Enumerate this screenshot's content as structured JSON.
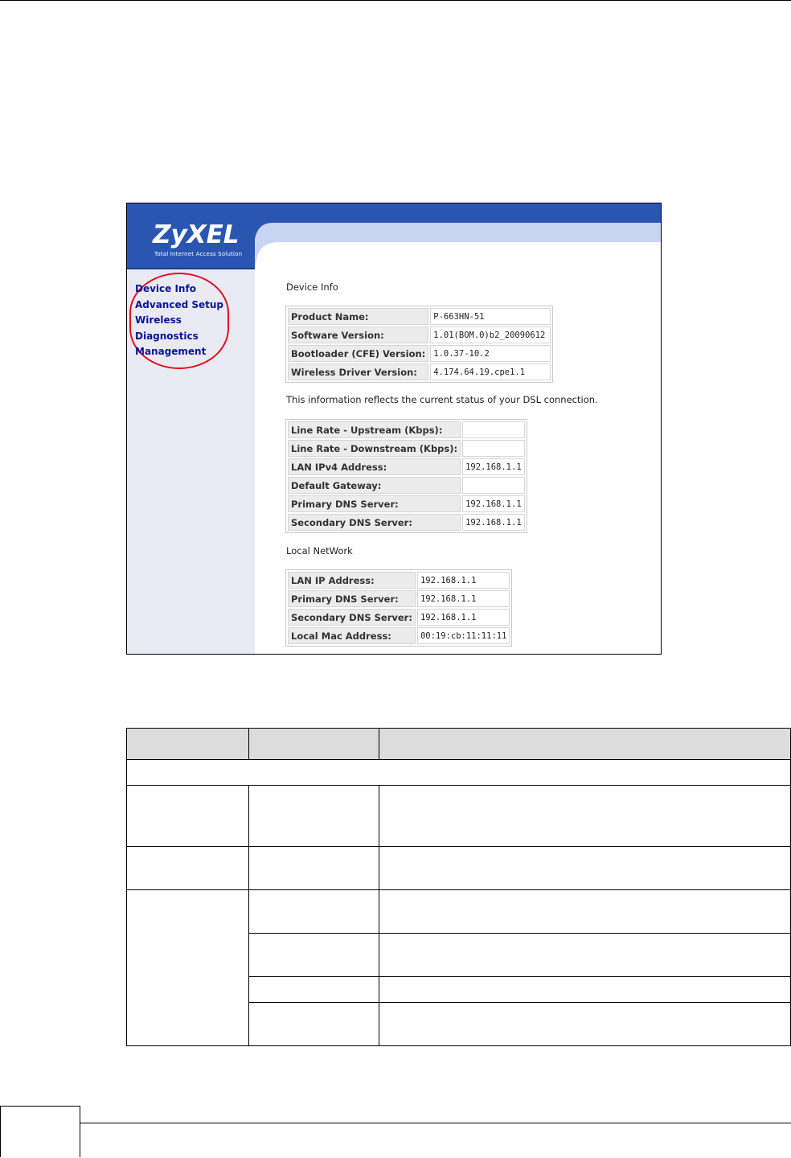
{
  "screenshot": {
    "logo": {
      "brand": "ZyXEL",
      "tagline": "Total Internet Access Solution"
    },
    "menu": [
      {
        "label": "Device Info"
      },
      {
        "label": "Advanced Setup"
      },
      {
        "label": "Wireless"
      },
      {
        "label": "Diagnostics"
      },
      {
        "label": "Management"
      }
    ],
    "device_info_title": "Device Info",
    "device_table": [
      {
        "label": "Product Name:",
        "value": "P-663HN-51"
      },
      {
        "label": "Software Version:",
        "value": "1.01(BOM.0)b2_20090612"
      },
      {
        "label": "Bootloader (CFE) Version:",
        "value": "1.0.37-10.2"
      },
      {
        "label": "Wireless Driver Version:",
        "value": "4.174.64.19.cpe1.1"
      }
    ],
    "status_note": "This information reflects the current status of your DSL connection.",
    "dsl_table": [
      {
        "label": "Line Rate - Upstream (Kbps):",
        "value": ""
      },
      {
        "label": "Line Rate - Downstream (Kbps):",
        "value": ""
      },
      {
        "label": "LAN IPv4 Address:",
        "value": "192.168.1.1"
      },
      {
        "label": "Default Gateway:",
        "value": ""
      },
      {
        "label": "Primary DNS Server:",
        "value": "192.168.1.1"
      },
      {
        "label": "Secondary DNS Server:",
        "value": "192.168.1.1"
      }
    ],
    "local_network_title": "Local NetWork",
    "local_table": [
      {
        "label": "LAN IP Address:",
        "value": "192.168.1.1"
      },
      {
        "label": "Primary DNS Server:",
        "value": "192.168.1.1"
      },
      {
        "label": "Secondary DNS Server:",
        "value": "192.168.1.1"
      },
      {
        "label": "Local Mac Address:",
        "value": "00:19:cb:11:11:11"
      }
    ]
  },
  "colors": {
    "brand_blue": "#2a56b2",
    "menu_link": "#0b1494",
    "highlight_circle": "#e1101a",
    "sidebar_bg": "#eaeaf5"
  }
}
